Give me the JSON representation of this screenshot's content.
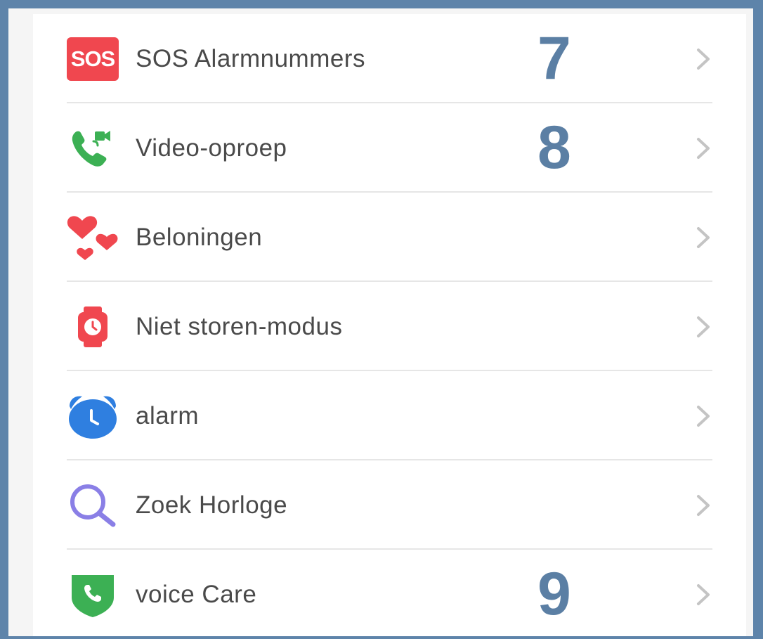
{
  "menu": {
    "items": [
      {
        "label": "SOS Alarmnummers",
        "icon": "sos-icon",
        "sos_text": "SOS",
        "annotation": "7"
      },
      {
        "label": "Video-oproep",
        "icon": "video-call-icon",
        "annotation": "8"
      },
      {
        "label": "Beloningen",
        "icon": "hearts-icon",
        "annotation": ""
      },
      {
        "label": "Niet storen-modus",
        "icon": "watch-icon",
        "annotation": ""
      },
      {
        "label": "alarm",
        "icon": "alarm-clock-icon",
        "annotation": ""
      },
      {
        "label": "Zoek Horloge",
        "icon": "search-icon",
        "annotation": ""
      },
      {
        "label": "voice Care",
        "icon": "voice-care-icon",
        "annotation": "9"
      }
    ]
  },
  "colors": {
    "frame": "#5e84aa",
    "annotation": "#5b7fa4",
    "sos_red": "#f0474f",
    "video_green": "#3cb054",
    "alarm_blue": "#2f7fe0",
    "search_purple": "#8a7fe6"
  }
}
